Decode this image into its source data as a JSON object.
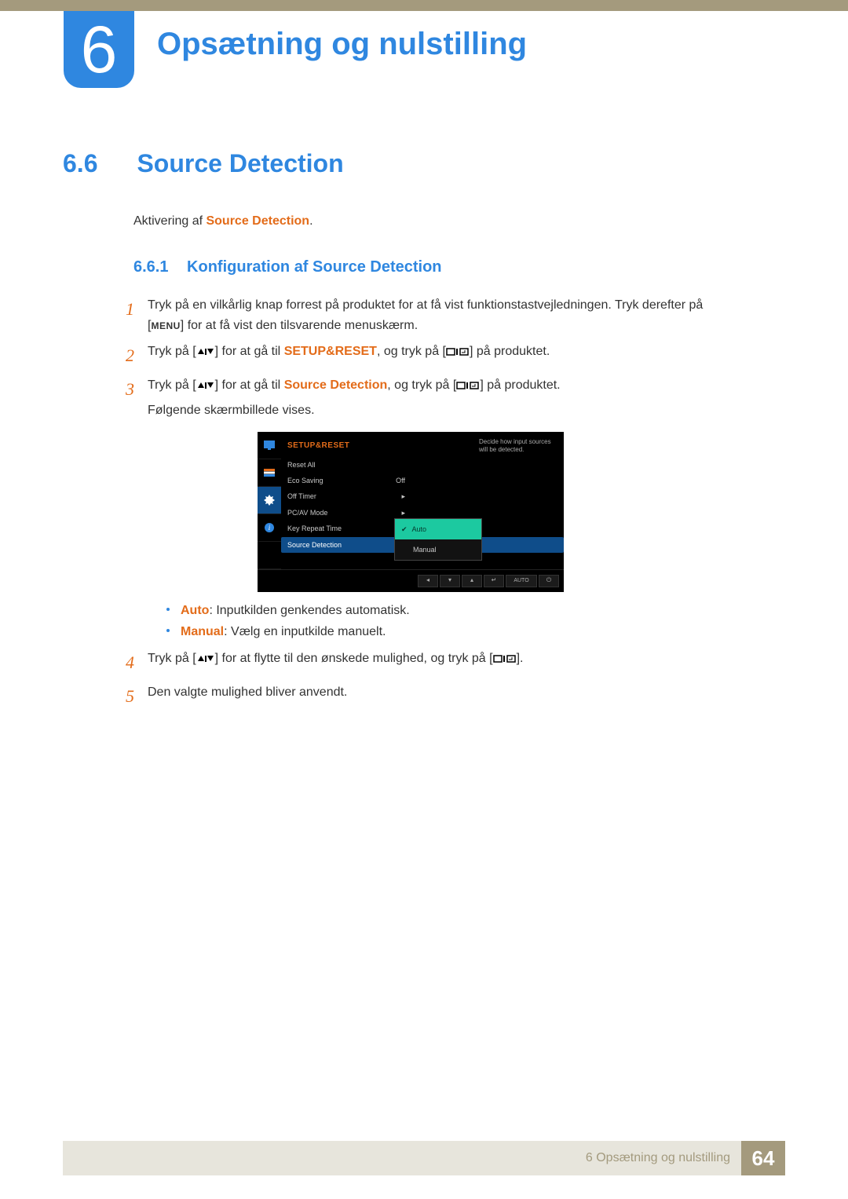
{
  "chapter": {
    "number": "6",
    "title": "Opsætning og nulstilling"
  },
  "section": {
    "number": "6.6",
    "title": "Source Detection"
  },
  "intro": {
    "prefix": "Aktivering af ",
    "highlight": "Source Detection",
    "suffix": "."
  },
  "subsection": {
    "number": "6.6.1",
    "title": "Konfiguration af Source Detection"
  },
  "steps": {
    "s1": {
      "num": "1",
      "line1a": "Tryk på en vilkårlig knap forrest på produktet for at få vist funktionstastvejledningen. Tryk derefter på",
      "line2a": "[",
      "menu": "MENU",
      "line2b": "] for at få vist den tilsvarende menuskærm."
    },
    "s2": {
      "num": "2",
      "a": "Tryk på [",
      "b": "] for at gå til ",
      "hl": "SETUP&RESET",
      "c": ", og tryk på [",
      "d": "] på produktet."
    },
    "s3": {
      "num": "3",
      "a": "Tryk på [",
      "b": "] for at gå til ",
      "hl": "Source Detection",
      "c": ", og tryk på [",
      "d": "] på produktet.",
      "follow": "Følgende skærmbillede vises."
    },
    "s4": {
      "num": "4",
      "a": "Tryk på [",
      "b": "] for at flytte til den ønskede mulighed, og tryk på [",
      "c": "]."
    },
    "s5": {
      "num": "5",
      "text": "Den valgte mulighed bliver anvendt."
    }
  },
  "bullets": {
    "b1": {
      "hl": "Auto",
      "text": ": Inputkilden genkendes automatisk."
    },
    "b2": {
      "hl": "Manual",
      "text": ": Vælg en inputkilde manuelt."
    }
  },
  "osd": {
    "title": "SETUP&RESET",
    "rows": {
      "reset": "Reset All",
      "eco": "Eco Saving",
      "eco_val": "Off",
      "offtimer": "Off Timer",
      "pcav": "PC/AV Mode",
      "keyrep": "Key Repeat Time",
      "srcdet": "Source Detection"
    },
    "popup": {
      "auto": "Auto",
      "manual": "Manual"
    },
    "tip": "Decide how input sources will be detected.",
    "footer": {
      "auto": "AUTO"
    }
  },
  "footer": {
    "label": "6 Opsætning og nulstilling",
    "page": "64"
  }
}
